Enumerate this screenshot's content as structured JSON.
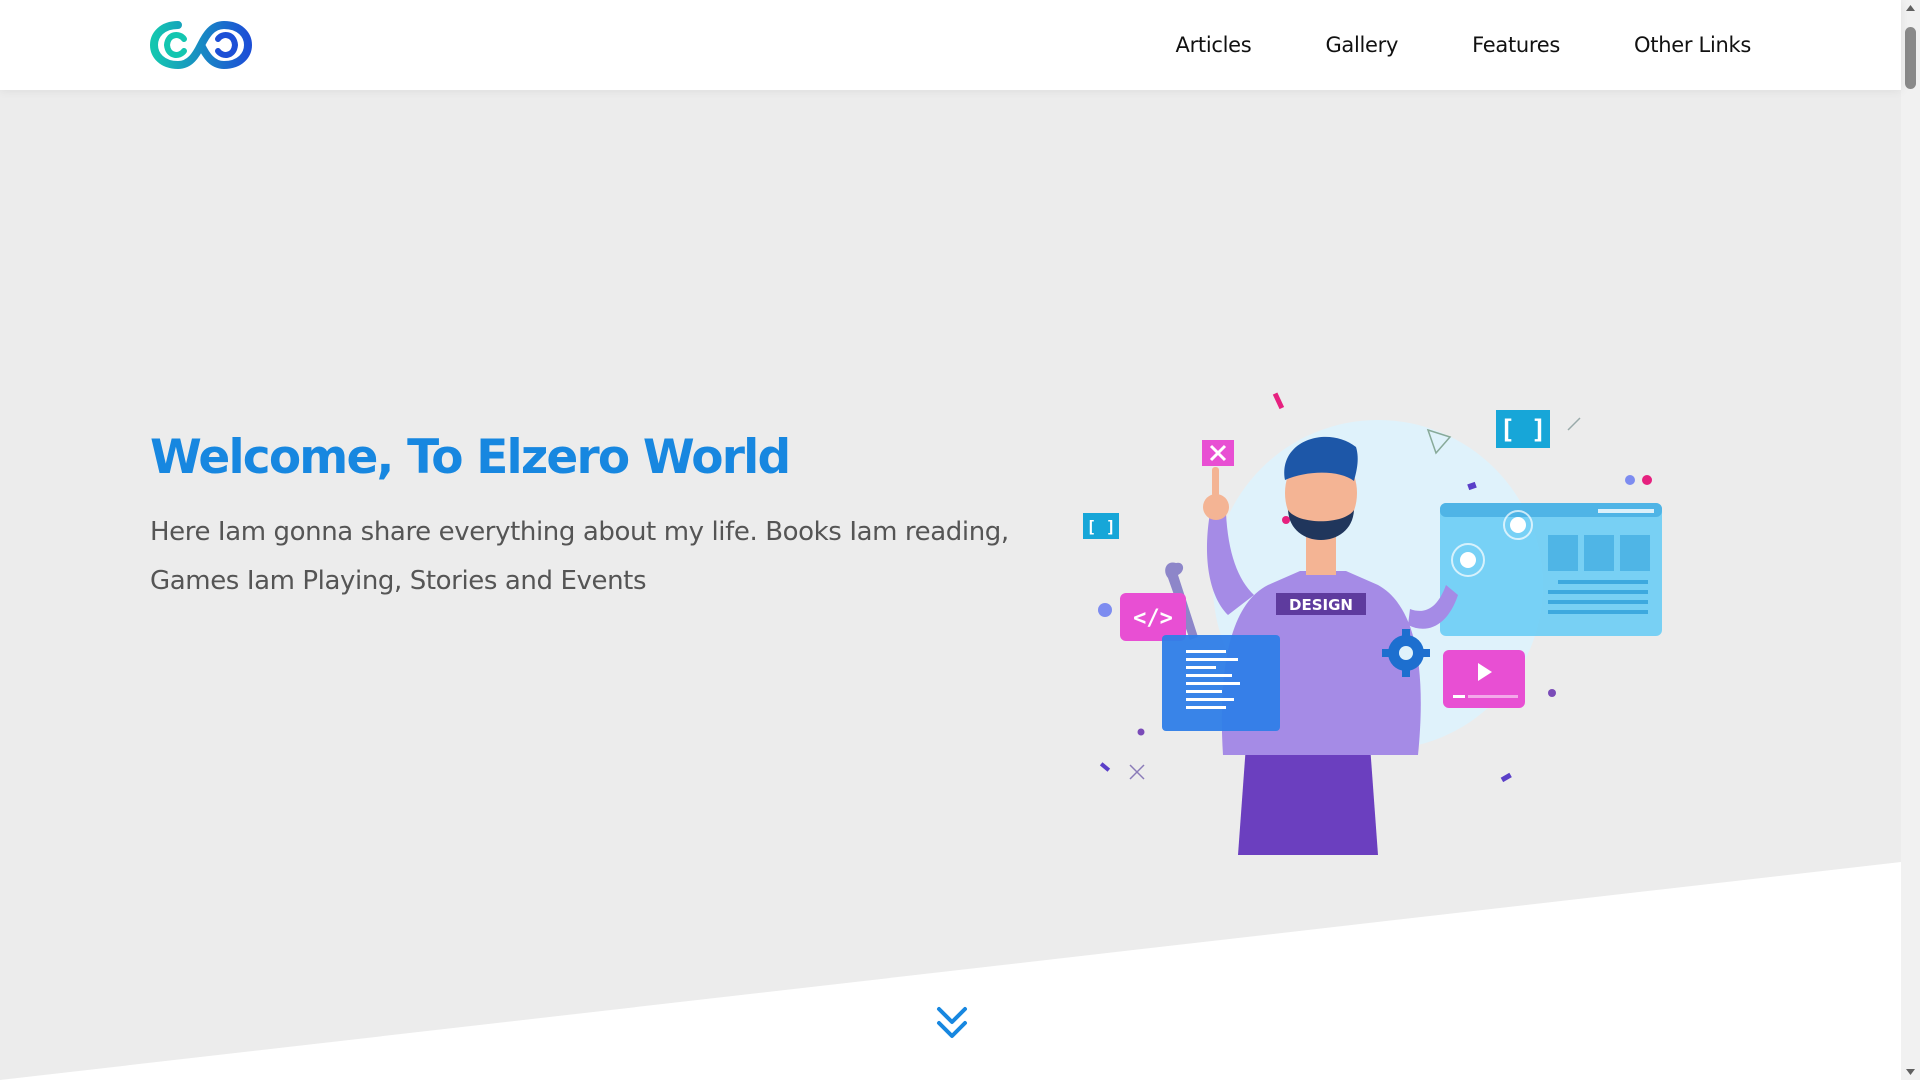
{
  "header": {
    "logo_icon": "infinity-logo-icon",
    "nav": [
      {
        "label": "Articles"
      },
      {
        "label": "Gallery"
      },
      {
        "label": "Features"
      },
      {
        "label": "Other Links"
      }
    ]
  },
  "landing": {
    "title": "Welcome, To Elzero World",
    "description": "Here Iam gonna share everything about my life. Books Iam reading, Games Iam Playing, Stories and Events",
    "illustration": {
      "icon": "developer-illustration",
      "shirt_label": "DESIGN"
    },
    "go_down_icon": "double-chevron-down-icon"
  },
  "colors": {
    "accent": "#1787e0",
    "landing_bg": "#ececec",
    "pink": "#e84fd3",
    "cyan": "#17a6d8"
  },
  "scrollbar": {
    "up_icon": "scroll-up-arrow-icon",
    "down_icon": "scroll-down-arrow-icon"
  }
}
